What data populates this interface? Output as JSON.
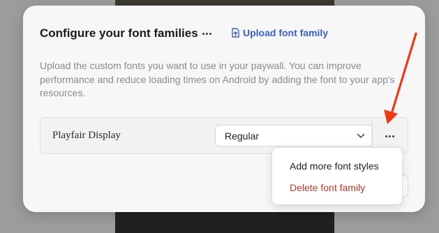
{
  "dialog": {
    "title": "Configure your font families",
    "more_icon": "ellipsis-icon",
    "upload_link": {
      "icon": "upload-file-icon",
      "label": "Upload font family"
    },
    "description": "Upload the custom fonts you want to use in your paywall. You can improve performance and reduce loading times on Android by adding the font to your app's resources."
  },
  "font_families": [
    {
      "name": "Playfair Display",
      "style": "Regular",
      "more_icon": "ellipsis-icon"
    }
  ],
  "context_menu": {
    "items": [
      {
        "label": "Add more font styles",
        "color": "#1f1f1f"
      },
      {
        "label": "Delete font family",
        "color": "#c0392b"
      }
    ]
  },
  "colors": {
    "accent": "#3b5fc9",
    "danger": "#c0392b",
    "annotation_arrow": "#f03a17"
  }
}
